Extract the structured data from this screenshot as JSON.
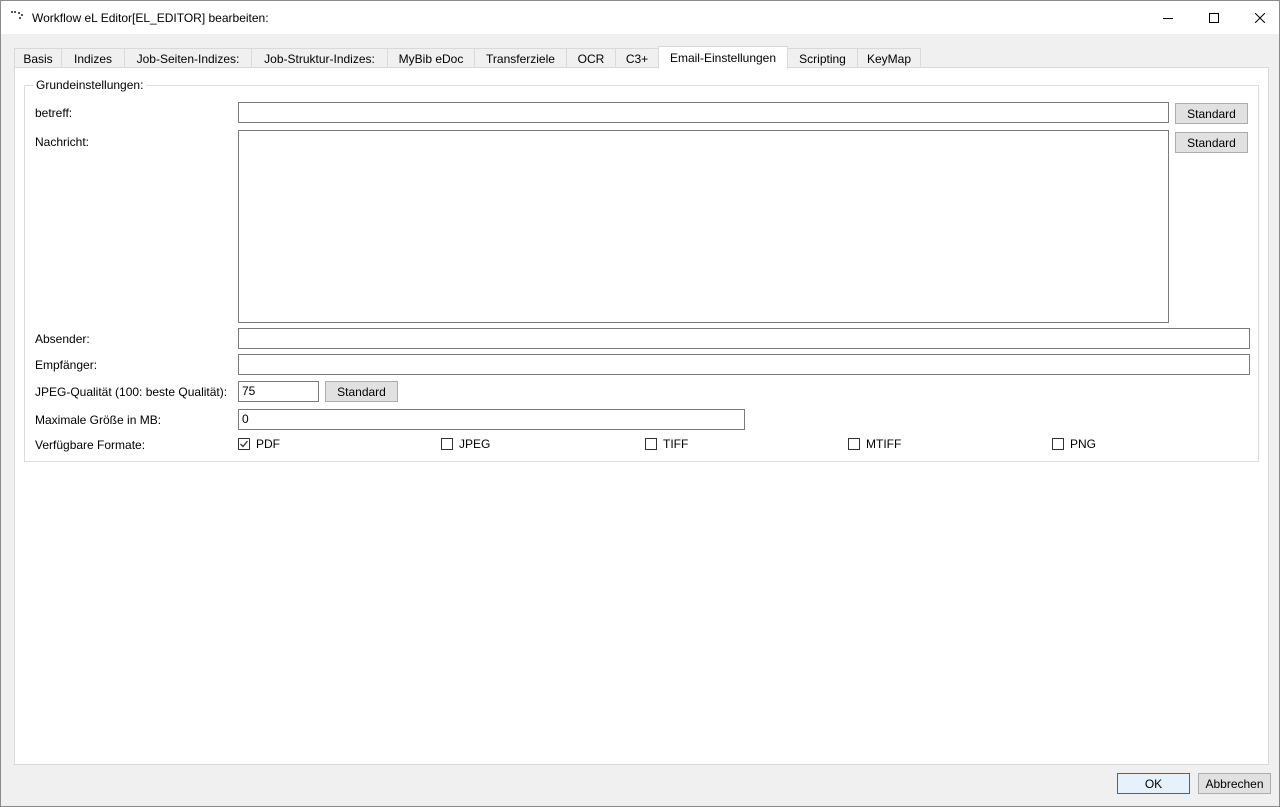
{
  "window": {
    "title": "Workflow eL Editor[EL_EDITOR] bearbeiten:",
    "icon": "app-icon",
    "controls": {
      "minimize": "minimize-icon",
      "maximize": "maximize-icon",
      "close": "close-icon"
    }
  },
  "tabs": [
    {
      "label": "Basis",
      "active": false
    },
    {
      "label": "Indizes",
      "active": false
    },
    {
      "label": "Job-Seiten-Indizes:",
      "active": false
    },
    {
      "label": "Job-Struktur-Indizes:",
      "active": false
    },
    {
      "label": "MyBib eDoc",
      "active": false
    },
    {
      "label": "Transferziele",
      "active": false
    },
    {
      "label": "OCR",
      "active": false
    },
    {
      "label": "C3+",
      "active": false
    },
    {
      "label": "Email-Einstellungen",
      "active": true
    },
    {
      "label": "Scripting",
      "active": false
    },
    {
      "label": "KeyMap",
      "active": false
    }
  ],
  "group": {
    "title": "Grundeinstellungen:",
    "betreff": {
      "label": "betreff:",
      "value": "",
      "button": "Standard"
    },
    "nachricht": {
      "label": "Nachricht:",
      "value": "",
      "button": "Standard"
    },
    "absender": {
      "label": "Absender:",
      "value": ""
    },
    "empfaenger": {
      "label": "Empfänger:",
      "value": ""
    },
    "jpeg": {
      "label": "JPEG-Qualität (100: beste Qualität):",
      "value": "75",
      "button": "Standard"
    },
    "maxsize": {
      "label": "Maximale Größe in MB:",
      "value": "0"
    },
    "formats": {
      "label": "Verfügbare Formate:",
      "options": [
        {
          "label": "PDF",
          "checked": true
        },
        {
          "label": "JPEG",
          "checked": false
        },
        {
          "label": "TIFF",
          "checked": false
        },
        {
          "label": "MTIFF",
          "checked": false
        },
        {
          "label": "PNG",
          "checked": false
        }
      ]
    }
  },
  "footer": {
    "ok": "OK",
    "cancel": "Abbrechen"
  },
  "colors": {
    "accent": "#0078d7",
    "button_bg": "#e1e1e1",
    "window_bg": "#f0f0f0"
  }
}
